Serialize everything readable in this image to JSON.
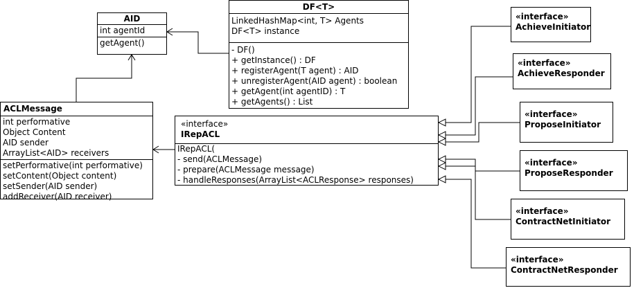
{
  "stereotype": "«interface»",
  "aid": {
    "name": "AID",
    "attributes": [
      "int agentId"
    ],
    "operations": [
      "getAgent()"
    ]
  },
  "df": {
    "name": "DF<T>",
    "attributes": [
      "LinkedHashMap<int, T> Agents",
      "DF<T> instance"
    ],
    "operations": [
      "- DF()",
      "+ getInstance() : DF",
      "+ registerAgent(T agent) : AID",
      "+ unregisterAgent(AID agent) : boolean",
      "+ getAgent(int agentID) : T",
      "+ getAgents() : List"
    ]
  },
  "acl": {
    "name": "ACLMessage",
    "attributes": [
      "int performative",
      "Object Content",
      "AID sender",
      "ArrayList<AID> receivers"
    ],
    "operations": [
      "setPerformative(int performative)",
      "setContent(Object content)",
      "setSender(AID sender)",
      "addReceiver(AID receiver)"
    ]
  },
  "irep": {
    "name": "IRepACL",
    "operations": [
      "IRepACL(",
      "- send(ACLMessage)",
      "- prepare(ACLMessage message)",
      "- handleResponses(ArrayList<ACLResponse> responses)"
    ]
  },
  "interfaces": [
    "AchieveInitiator",
    "AchieveResponder",
    "ProposeInitiator",
    "ProposeResponder",
    "ContractNetInitiator",
    "ContractNetResponder"
  ]
}
